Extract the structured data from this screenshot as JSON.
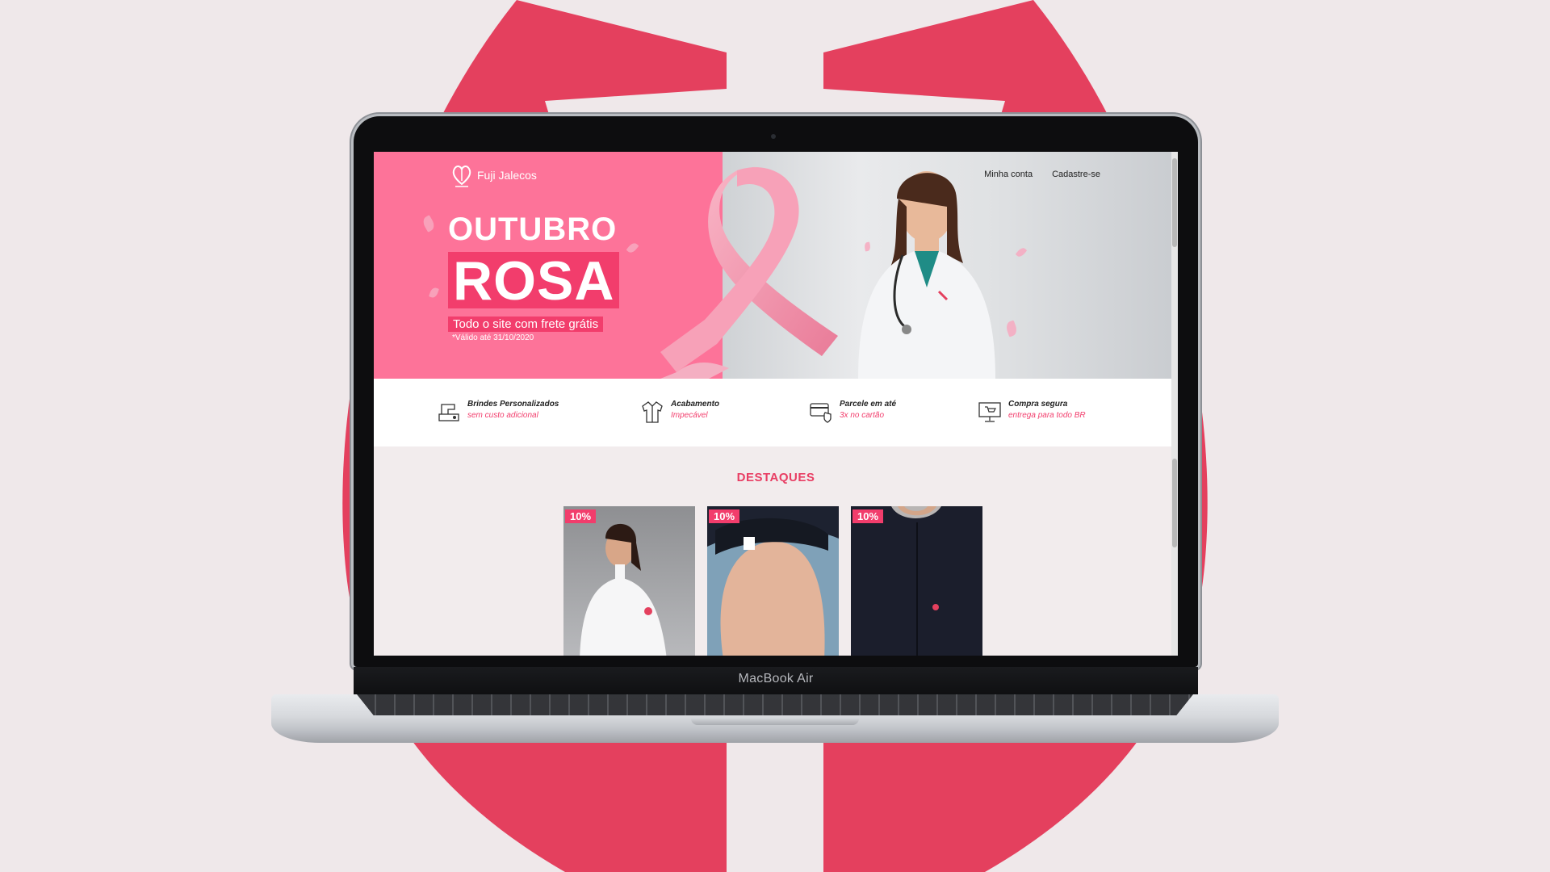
{
  "colors": {
    "brand_pink": "#fd7399",
    "accent": "#f23d6c",
    "heading": "#e83d63",
    "bg_heart": "#e4405e"
  },
  "device": {
    "label": "MacBook Air"
  },
  "site": {
    "logo_text": "Fuji Jalecos",
    "nav": {
      "account": "Minha conta",
      "register": "Cadastre-se"
    },
    "hero": {
      "title_line1": "OUTUBRO",
      "title_line2": "ROSA",
      "subtitle": "Todo o site com frete grátis",
      "note": "*Válido até 31/10/2020"
    },
    "benefits": [
      {
        "icon": "sewing-machine-icon",
        "title": "Brindes Personalizados",
        "subtitle": "sem custo adicional"
      },
      {
        "icon": "lab-coat-icon",
        "title": "Acabamento",
        "subtitle": "Impecável"
      },
      {
        "icon": "credit-card-shield-icon",
        "title": "Parcele em até",
        "subtitle": "3x no cartão"
      },
      {
        "icon": "monitor-cart-icon",
        "title": "Compra segura",
        "subtitle": "entrega para todo BR"
      }
    ],
    "featured": {
      "title": "DESTAQUES",
      "products": [
        {
          "badge": "10%",
          "image": "white-lab-coat-woman"
        },
        {
          "badge": "10%",
          "image": "black-scrub-cap"
        },
        {
          "badge": "10%",
          "image": "black-vest"
        }
      ]
    }
  }
}
